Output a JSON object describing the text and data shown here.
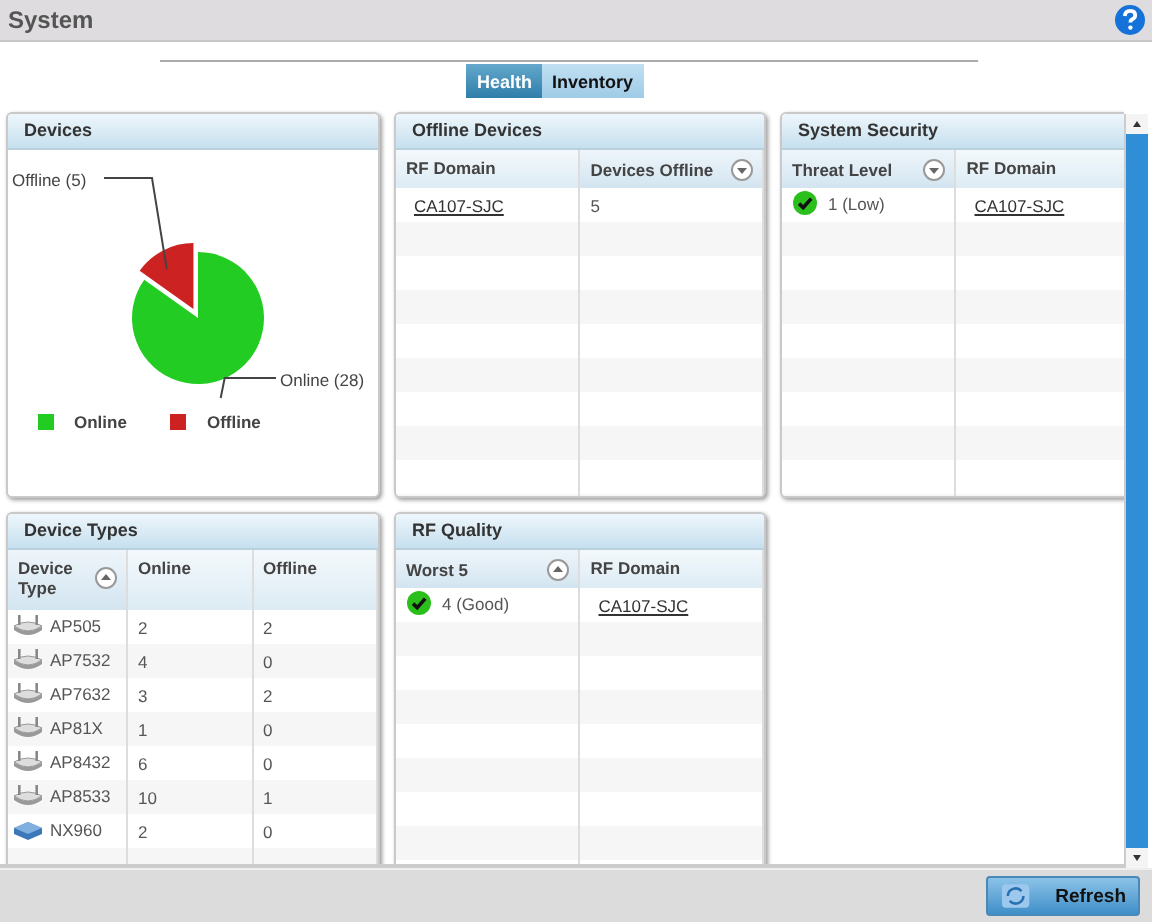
{
  "window": {
    "title": "System"
  },
  "tabs": [
    {
      "label": "Health",
      "selected": true
    },
    {
      "label": "Inventory",
      "selected": false
    }
  ],
  "devices": {
    "title": "Devices",
    "chart_data": {
      "type": "pie",
      "categories": [
        "Online",
        "Offline"
      ],
      "values": [
        28,
        5
      ],
      "value_labels": [
        "Online (28)",
        "Offline (5)"
      ]
    },
    "legend": [
      {
        "color": "#22cc22"
      },
      {
        "color": "#cc2222"
      }
    ]
  },
  "offline_devices": {
    "title": "Offline Devices",
    "columns": [
      {
        "label": "RF Domain",
        "sorted": false
      },
      {
        "label": "Devices Offline",
        "sorted": true,
        "ascending": false
      }
    ],
    "rows": [
      [
        {
          "text": "CA107-SJC",
          "kind": "link"
        },
        {
          "text": "5",
          "kind": "plain"
        }
      ]
    ]
  },
  "system_security": {
    "title": "System Security",
    "columns": [
      {
        "label": "Threat Level",
        "sorted": true,
        "ascending": false
      },
      {
        "label": "RF Domain",
        "sorted": false
      }
    ],
    "rows": [
      [
        {
          "text": "1 (Low)",
          "kind": "check"
        },
        {
          "text": "CA107-SJC",
          "kind": "link"
        }
      ]
    ]
  },
  "device_types": {
    "title": "Device Types",
    "columns": [
      {
        "label": "Device Type",
        "sorted": true,
        "ascending": true
      },
      {
        "label": "Online",
        "sorted": false
      },
      {
        "label": "Offline",
        "sorted": false
      }
    ],
    "rows": [
      [
        {
          "text": "AP505",
          "kind": "ap"
        },
        {
          "text": "2",
          "kind": "plain"
        },
        {
          "text": "2",
          "kind": "plain"
        }
      ],
      [
        {
          "text": "AP7532",
          "kind": "ap"
        },
        {
          "text": "4",
          "kind": "plain"
        },
        {
          "text": "0",
          "kind": "plain"
        }
      ],
      [
        {
          "text": "AP7632",
          "kind": "ap"
        },
        {
          "text": "3",
          "kind": "plain"
        },
        {
          "text": "2",
          "kind": "plain"
        }
      ],
      [
        {
          "text": "AP81X",
          "kind": "ap"
        },
        {
          "text": "1",
          "kind": "plain"
        },
        {
          "text": "0",
          "kind": "plain"
        }
      ],
      [
        {
          "text": "AP8432",
          "kind": "ap"
        },
        {
          "text": "6",
          "kind": "plain"
        },
        {
          "text": "0",
          "kind": "plain"
        }
      ],
      [
        {
          "text": "AP8533",
          "kind": "ap"
        },
        {
          "text": "10",
          "kind": "plain"
        },
        {
          "text": "1",
          "kind": "plain"
        }
      ],
      [
        {
          "text": "NX960",
          "kind": "controller"
        },
        {
          "text": "2",
          "kind": "plain"
        },
        {
          "text": "0",
          "kind": "plain"
        }
      ]
    ]
  },
  "rf_quality": {
    "title": "RF Quality",
    "columns": [
      {
        "label": "Worst 5",
        "sorted": true,
        "ascending": true
      },
      {
        "label": "RF Domain",
        "sorted": false
      }
    ],
    "rows": [
      [
        {
          "text": "4 (Good)",
          "kind": "check"
        },
        {
          "text": "CA107-SJC",
          "kind": "link"
        }
      ]
    ]
  },
  "buttons": [
    {
      "label": "Refresh"
    }
  ]
}
